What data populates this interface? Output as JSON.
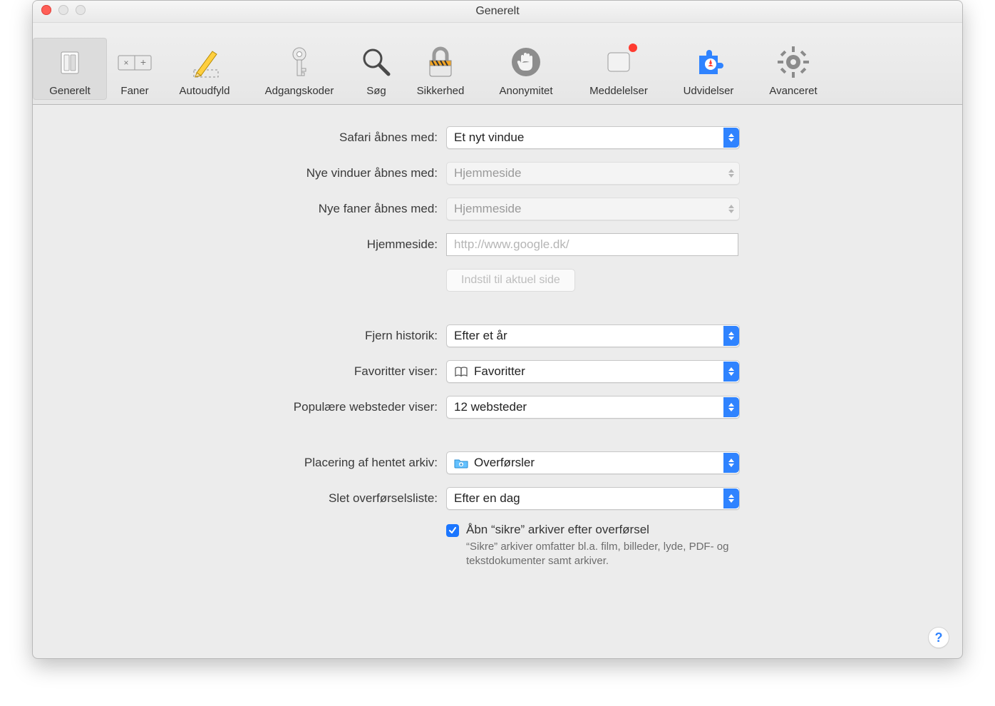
{
  "window": {
    "title": "Generelt"
  },
  "toolbar": {
    "items": [
      {
        "label": "Generelt"
      },
      {
        "label": "Faner"
      },
      {
        "label": "Autoudfyld"
      },
      {
        "label": "Adgangskoder"
      },
      {
        "label": "Søg"
      },
      {
        "label": "Sikkerhed"
      },
      {
        "label": "Anonymitet"
      },
      {
        "label": "Meddelelser"
      },
      {
        "label": "Udvidelser"
      },
      {
        "label": "Avanceret"
      }
    ]
  },
  "form": {
    "open_with_label": "Safari åbnes med:",
    "open_with_value": "Et nyt vindue",
    "new_windows_label": "Nye vinduer åbnes med:",
    "new_windows_value": "Hjemmeside",
    "new_tabs_label": "Nye faner åbnes med:",
    "new_tabs_value": "Hjemmeside",
    "homepage_label": "Hjemmeside:",
    "homepage_placeholder": "http://www.google.dk/",
    "set_current_label": "Indstil til aktuel side",
    "remove_history_label": "Fjern historik:",
    "remove_history_value": "Efter et år",
    "favorites_label": "Favoritter viser:",
    "favorites_value": "Favoritter",
    "popular_label": "Populære websteder viser:",
    "popular_value": "12 websteder",
    "download_loc_label": "Placering af hentet arkiv:",
    "download_loc_value": "Overførsler",
    "clear_dl_label": "Slet overførselsliste:",
    "clear_dl_value": "Efter en dag",
    "safe_open_label": "Åbn “sikre” arkiver efter overførsel",
    "safe_open_hint": "“Sikre” arkiver omfatter bl.a. film, billeder, lyde, PDF- og tekstdokumenter samt arkiver."
  },
  "help": {
    "label": "?"
  }
}
